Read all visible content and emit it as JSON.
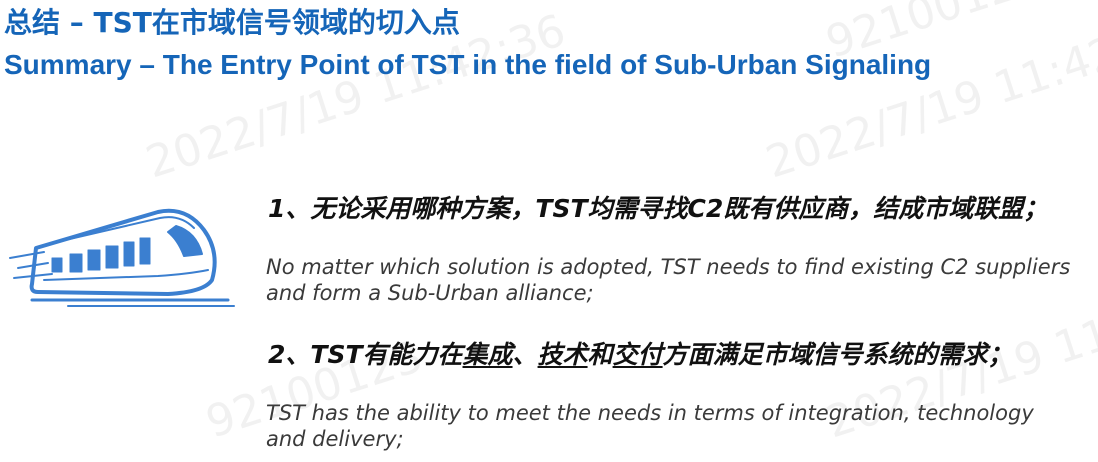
{
  "title": {
    "cn": "总结 – TST在市域信号领域的切入点",
    "en": "Summary – The Entry Point of TST in the field of Sub-Urban Signaling"
  },
  "points": [
    {
      "cn": "1、无论采用哪种方案，TST均需寻找C2既有供应商，结成市域联盟；",
      "en": "No matter which solution is adopted, TST needs to find existing C2 suppliers and form a Sub-Urban alliance;"
    },
    {
      "cn_parts": [
        "2、TST有能力在",
        "集成",
        "、",
        "技术",
        "和",
        "交付",
        "方面满足市域信号系统的需求；"
      ],
      "en": "TST has the ability to meet the needs in terms of integration, technology and delivery;"
    }
  ],
  "watermark": {
    "id": "92100123",
    "timestamp": "2022/7/19 11:42:36"
  },
  "colors": {
    "title": "#1565b8",
    "train": "#3b7fd0"
  },
  "icons": [
    "train-icon"
  ]
}
